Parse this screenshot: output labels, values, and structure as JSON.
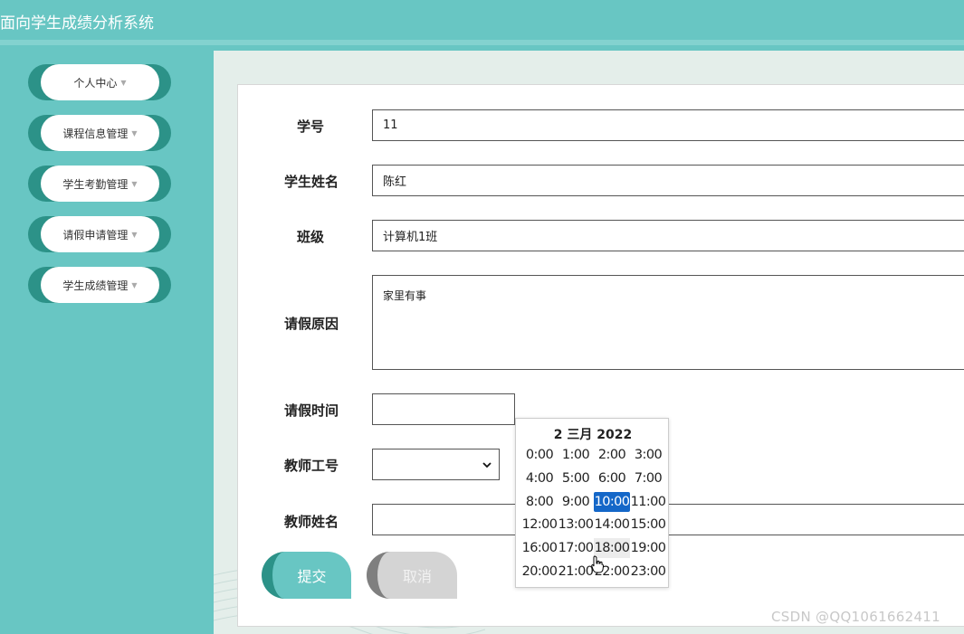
{
  "header": {
    "title": "面向学生成绩分析系统"
  },
  "sidebar": {
    "items": [
      {
        "label": "个人中心"
      },
      {
        "label": "课程信息管理"
      },
      {
        "label": "学生考勤管理"
      },
      {
        "label": "请假申请管理"
      },
      {
        "label": "学生成绩管理"
      }
    ]
  },
  "form": {
    "student_id": {
      "label": "学号",
      "value": "11"
    },
    "student_name": {
      "label": "学生姓名",
      "value": "陈红"
    },
    "class": {
      "label": "班级",
      "value": "计算机1班"
    },
    "reason": {
      "label": "请假原因",
      "value": "家里有事"
    },
    "leave_time": {
      "label": "请假时间",
      "value": ""
    },
    "teacher_id": {
      "label": "教师工号",
      "value": ""
    },
    "teacher_name": {
      "label": "教师姓名",
      "value": ""
    },
    "submit_label": "提交",
    "cancel_label": "取消"
  },
  "time_picker": {
    "title": "2 三月 2022",
    "selected": "10:00",
    "hovered": "18:00",
    "rows": [
      [
        "0:00",
        "1:00",
        "2:00",
        "3:00"
      ],
      [
        "4:00",
        "5:00",
        "6:00",
        "7:00"
      ],
      [
        "8:00",
        "9:00",
        "10:00",
        "11:00"
      ],
      [
        "12:00",
        "13:00",
        "14:00",
        "15:00"
      ],
      [
        "16:00",
        "17:00",
        "18:00",
        "19:00"
      ],
      [
        "20:00",
        "21:00",
        "22:00",
        "23:00"
      ]
    ]
  },
  "watermark": "CSDN @QQ1061662411",
  "colors": {
    "theme": "#68c6c3",
    "theme_dark": "#2c9288",
    "selected": "#1467c8"
  }
}
